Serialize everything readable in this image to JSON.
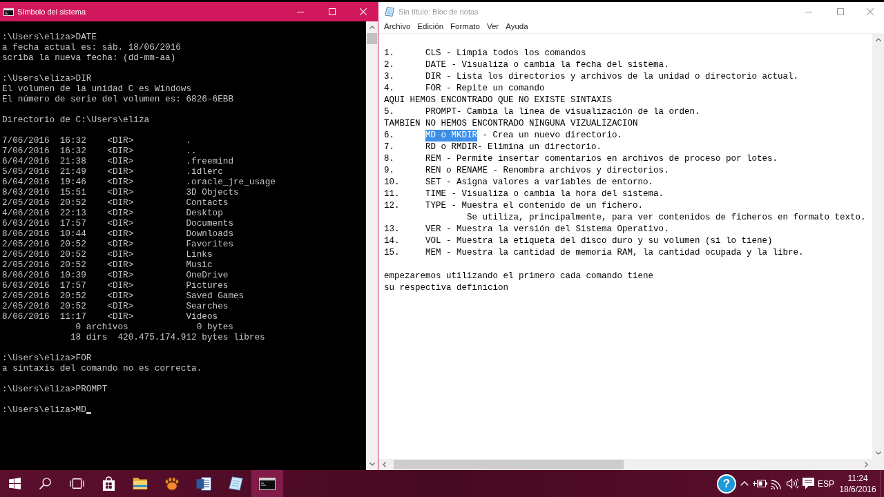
{
  "console_window": {
    "title": "Símbolo del sistema",
    "active": true,
    "blocks": [
      [
        {
          "kind": "line",
          "text": ":\\Users\\eliza>DATE"
        },
        {
          "kind": "line",
          "text": "a fecha actual es: sáb. 18/06/2016"
        },
        {
          "kind": "line",
          "text": "scriba la nueva fecha: (dd-mm-aa)"
        }
      ],
      [
        {
          "kind": "line",
          "text": ":\\Users\\eliza>DIR"
        },
        {
          "kind": "line",
          "text": "El volumen de la unidad C es Windows"
        },
        {
          "kind": "line",
          "text": "El número de serie del volumen es: 6826-6EBB"
        }
      ],
      [
        {
          "kind": "line",
          "text": "Directorio de C:\\Users\\eliza"
        }
      ],
      [
        {
          "kind": "entry",
          "date": "7/06/2016",
          "time": "16:32",
          "type": "<DIR>",
          "name": "."
        },
        {
          "kind": "entry",
          "date": "7/06/2016",
          "time": "16:32",
          "type": "<DIR>",
          "name": ".."
        },
        {
          "kind": "entry",
          "date": "6/04/2016",
          "time": "21:38",
          "type": "<DIR>",
          "name": ".freemind"
        },
        {
          "kind": "entry",
          "date": "5/05/2016",
          "time": "21:49",
          "type": "<DIR>",
          "name": ".idlerc"
        },
        {
          "kind": "entry",
          "date": "6/04/2016",
          "time": "19:46",
          "type": "<DIR>",
          "name": ".oracle_jre_usage"
        },
        {
          "kind": "entry",
          "date": "8/03/2016",
          "time": "15:51",
          "type": "<DIR>",
          "name": "3D Objects"
        },
        {
          "kind": "entry",
          "date": "2/05/2016",
          "time": "20:52",
          "type": "<DIR>",
          "name": "Contacts"
        },
        {
          "kind": "entry",
          "date": "4/06/2016",
          "time": "22:13",
          "type": "<DIR>",
          "name": "Desktop"
        },
        {
          "kind": "entry",
          "date": "6/03/2016",
          "time": "17:57",
          "type": "<DIR>",
          "name": "Documents"
        },
        {
          "kind": "entry",
          "date": "8/06/2016",
          "time": "10:44",
          "type": "<DIR>",
          "name": "Downloads"
        },
        {
          "kind": "entry",
          "date": "2/05/2016",
          "time": "20:52",
          "type": "<DIR>",
          "name": "Favorites"
        },
        {
          "kind": "entry",
          "date": "2/05/2016",
          "time": "20:52",
          "type": "<DIR>",
          "name": "Links"
        },
        {
          "kind": "entry",
          "date": "2/05/2016",
          "time": "20:52",
          "type": "<DIR>",
          "name": "Music"
        },
        {
          "kind": "entry",
          "date": "8/06/2016",
          "time": "10:39",
          "type": "<DIR>",
          "name": "OneDrive"
        },
        {
          "kind": "entry",
          "date": "6/03/2016",
          "time": "17:57",
          "type": "<DIR>",
          "name": "Pictures"
        },
        {
          "kind": "entry",
          "date": "2/05/2016",
          "time": "20:52",
          "type": "<DIR>",
          "name": "Saved Games"
        },
        {
          "kind": "entry",
          "date": "2/05/2016",
          "time": "20:52",
          "type": "<DIR>",
          "name": "Searches"
        },
        {
          "kind": "entry",
          "date": "8/06/2016",
          "time": "11:17",
          "type": "<DIR>",
          "name": "Videos"
        },
        {
          "kind": "total",
          "count": "0 archivos",
          "size": "0 bytes"
        },
        {
          "kind": "total",
          "count": "18 dirs",
          "size": "420.475.174.912 bytes libres"
        }
      ],
      [
        {
          "kind": "line",
          "text": ":\\Users\\eliza>FOR"
        },
        {
          "kind": "line",
          "text": "a sintaxis del comando no es correcta."
        }
      ],
      [
        {
          "kind": "line",
          "text": ":\\Users\\eliza>PROMPT"
        }
      ],
      [
        {
          "kind": "input",
          "text": ":\\Users\\eliza>MD"
        }
      ]
    ]
  },
  "notepad_window": {
    "title": "Sin título: Bloc de notas",
    "active": false,
    "menu": [
      "Archivo",
      "Edición",
      "Formato",
      "Ver",
      "Ayuda"
    ],
    "blocks": [
      [
        {
          "kind": "numbered",
          "number": "1.",
          "text": "CLS - Limpia todos los comandos"
        },
        {
          "kind": "numbered",
          "number": "2.",
          "text": "DATE - Visualiza o cambia la fecha del sistema."
        },
        {
          "kind": "numbered",
          "number": "3.",
          "text": "DIR - Lista los directorios y archivos de la unidad o directorio actual."
        },
        {
          "kind": "numbered",
          "number": "4.",
          "text": "FOR - Repite un comando"
        },
        {
          "kind": "plain",
          "text": "AQUI HEMOS ENCONTRADO QUE NO EXISTE SINTAXIS"
        },
        {
          "kind": "numbered",
          "number": "5.",
          "text": "PROMPT- Cambia la línea de visualización de la orden."
        },
        {
          "kind": "plain",
          "text": "TAMBIEN NO HEMOS ENCONTRADO NINGUNA VIZUALIZACION"
        },
        {
          "kind": "numbered",
          "number": "6.",
          "segments": [
            {
              "text": "MD o MKDIR",
              "selected": true
            },
            {
              "text": "- Crea un nuevo directorio.",
              "selected": false
            }
          ]
        },
        {
          "kind": "numbered",
          "number": "7.",
          "text": "RD o RMDIR- Elimina un directorio."
        },
        {
          "kind": "numbered",
          "number": "8.",
          "text": "REM - Permite insertar comentarios en archivos de proceso por lotes."
        },
        {
          "kind": "numbered",
          "number": "9.",
          "text": "REN o RENAME - Renombra archivos y directorios."
        },
        {
          "kind": "numbered",
          "number": "10.",
          "text": "SET - Asigna valores a variables de entorno."
        },
        {
          "kind": "numbered",
          "number": "11.",
          "text": "TIME - Visualiza o cambia la hora del sistema."
        },
        {
          "kind": "numbered",
          "number": "12.",
          "text": "TYPE - Muestra el contenido de un fichero."
        },
        {
          "kind": "indented",
          "text": "Se utiliza, principalmente, para ver contenidos de ficheros en formato texto."
        },
        {
          "kind": "numbered",
          "number": "13.",
          "text": "VER - Muestra la versión del Sistema Operativo."
        },
        {
          "kind": "numbered",
          "number": "14.",
          "text": "VOL - Muestra la etiqueta del disco duro y su volumen (si lo tiene)"
        },
        {
          "kind": "numbered",
          "number": "15.",
          "text": "MEM - Muestra la cantidad de memoria RAM, la cantidad ocupada y la libre."
        }
      ],
      [
        {
          "kind": "plain",
          "text": "empezaremos utilizando el primero cada comando tiene"
        },
        {
          "kind": "plain",
          "text": "su respectiva definicion"
        }
      ]
    ]
  },
  "taskbar": {
    "apps": [
      {
        "kind": "store",
        "active": false
      },
      {
        "kind": "files",
        "active": false
      },
      {
        "kind": "paw",
        "active": false
      },
      {
        "kind": "word",
        "active": false
      },
      {
        "kind": "notepad",
        "active": false
      },
      {
        "kind": "console",
        "active": true
      }
    ],
    "tray": {
      "help": "?",
      "language": "ESP",
      "time": "11:24",
      "date": "18/6/2016"
    }
  }
}
